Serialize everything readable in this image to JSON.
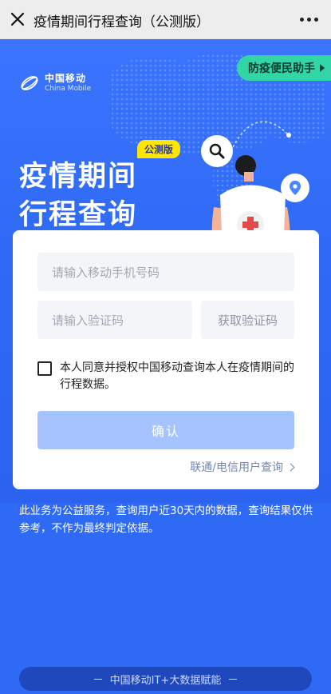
{
  "topbar": {
    "title": "疫情期间行程查询（公测版）",
    "close_icon": "close-icon",
    "more_icon": "more-dots-icon"
  },
  "brand": {
    "cn": "中国移动",
    "en": "China Mobile"
  },
  "hero": {
    "badge": "公测版",
    "title": "疫情期间\n行程查询",
    "helper_label": "防疫便民助手"
  },
  "form": {
    "phone_placeholder": "请输入移动手机号码",
    "code_placeholder": "请输入验证码",
    "get_code_label": "获取验证码",
    "agreement_text": "本人同意并授权中国移动查询本人在疫情期间的行程数据。",
    "confirm_label": "确认",
    "unicom_link": "联通/电信用户查询"
  },
  "notice": "此业务为公益服务，查询用户近30天内的数据，查询结果仅供参考，不作为最终判定依据。",
  "footer": "中国移动IT+大数据赋能",
  "colors": {
    "primary": "#2f6af5",
    "helper": "#32d6a6",
    "badge": "#ffe600",
    "confirm_disabled": "#a4c3ff"
  }
}
